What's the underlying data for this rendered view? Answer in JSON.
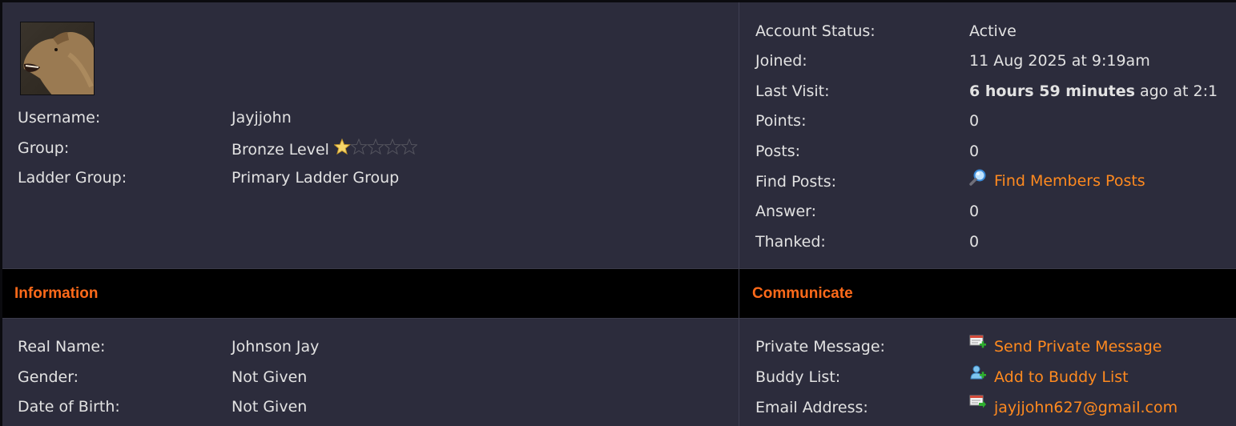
{
  "profile": {
    "rows": [
      {
        "label": "Username:",
        "value": "Jayjjohn"
      },
      {
        "label": "Group:",
        "value": "Bronze Level",
        "stars_filled": 1,
        "stars_total": 5
      },
      {
        "label": "Ladder Group:",
        "value": "Primary Ladder Group"
      }
    ]
  },
  "stats": {
    "account_status": {
      "label": "Account Status:",
      "value": "Active"
    },
    "joined": {
      "label": "Joined:",
      "value": "11 Aug 2025 at 9:19am"
    },
    "last_visit": {
      "label": "Last Visit:",
      "bold": "6 hours 59 minutes",
      "rest": " ago at 2:1"
    },
    "points": {
      "label": "Points:",
      "value": "0"
    },
    "posts": {
      "label": "Posts:",
      "value": "0"
    },
    "find_posts": {
      "label": "Find Posts:",
      "link": "Find Members Posts",
      "icon": "magnifier-icon"
    },
    "answer": {
      "label": "Answer:",
      "value": "0"
    },
    "thanked": {
      "label": "Thanked:",
      "value": "0"
    }
  },
  "sections": {
    "information": "Information",
    "communicate": "Communicate"
  },
  "information": {
    "rows": [
      {
        "label": "Real Name:",
        "value": "Johnson Jay"
      },
      {
        "label": "Gender:",
        "value": "Not Given"
      },
      {
        "label": "Date of Birth:",
        "value": "Not Given"
      }
    ]
  },
  "communicate": {
    "rows": [
      {
        "label": "Private Message:",
        "link": "Send Private Message",
        "icon": "message-add-icon"
      },
      {
        "label": "Buddy List:",
        "link": "Add to Buddy List",
        "icon": "add-buddy-icon"
      },
      {
        "label": "Email Address:",
        "link": "jayjjohn627@gmail.com",
        "icon": "email-icon"
      }
    ]
  },
  "colors": {
    "background": "#2c2c3c",
    "band": "#000000",
    "section_title": "#ff6a1a",
    "link": "#ff8a1f",
    "text": "#e2e2e2"
  }
}
